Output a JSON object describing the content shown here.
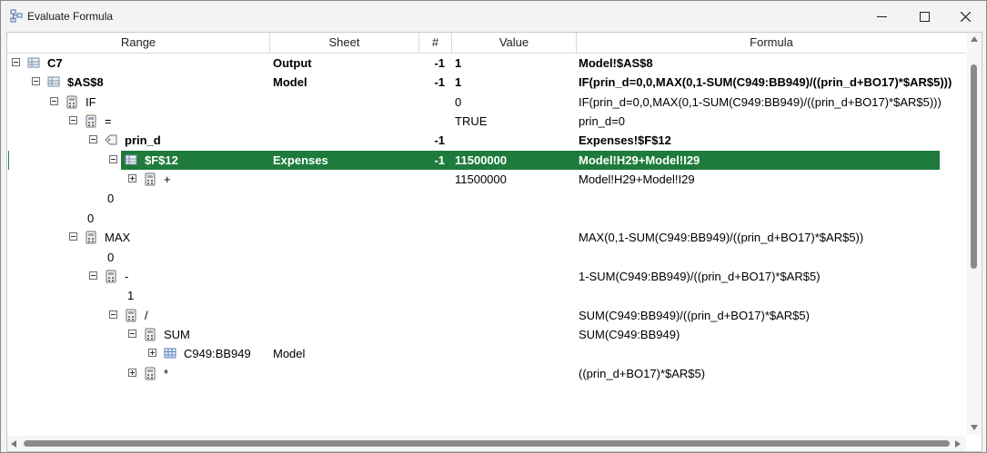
{
  "window": {
    "title": "Evaluate Formula"
  },
  "columns": {
    "range": "Range",
    "sheet": "Sheet",
    "num": "#",
    "value": "Value",
    "formula": "Formula"
  },
  "rows": [
    {
      "range": "C7",
      "sheet": "Output",
      "num": "-1",
      "value": "1",
      "formula": "Model!$AS$8",
      "bold": true,
      "icon": "range-icon"
    },
    {
      "range": "$AS$8",
      "sheet": "Model",
      "num": "-1",
      "value": "1",
      "formula": "IF(prin_d=0,0,MAX(0,1-SUM(C949:BB949)/((prin_d+BO17)*$AR$5)))",
      "bold": true,
      "icon": "range-icon"
    },
    {
      "range": "IF",
      "sheet": "",
      "num": "",
      "value": "0",
      "formula": "IF(prin_d=0,0,MAX(0,1-SUM(C949:BB949)/((prin_d+BO17)*$AR$5)))",
      "icon": "calculator-icon"
    },
    {
      "range": "=",
      "sheet": "",
      "num": "",
      "value": "TRUE",
      "formula": "prin_d=0",
      "icon": "calculator-icon"
    },
    {
      "range": "prin_d",
      "sheet": "",
      "num": "-1",
      "value": "",
      "formula": "Expenses!$F$12",
      "bold": true,
      "icon": "name-tag-icon"
    },
    {
      "range": "$F$12",
      "sheet": "Expenses",
      "num": "-1",
      "value": "11500000",
      "formula": "Model!H29+Model!I29",
      "bold": true,
      "selected": true,
      "icon": "range-icon"
    },
    {
      "range": "+",
      "sheet": "",
      "num": "",
      "value": "11500000",
      "formula": "Model!H29+Model!I29",
      "icon": "calculator-icon"
    },
    {
      "range": "0",
      "sheet": "",
      "num": "",
      "value": "",
      "formula": ""
    },
    {
      "range": "0",
      "sheet": "",
      "num": "",
      "value": "",
      "formula": ""
    },
    {
      "range": "MAX",
      "sheet": "",
      "num": "",
      "value": "",
      "formula": "MAX(0,1-SUM(C949:BB949)/((prin_d+BO17)*$AR$5))",
      "icon": "calculator-icon"
    },
    {
      "range": "0",
      "sheet": "",
      "num": "",
      "value": "",
      "formula": ""
    },
    {
      "range": "-",
      "sheet": "",
      "num": "",
      "value": "",
      "formula": "1-SUM(C949:BB949)/((prin_d+BO17)*$AR$5)",
      "icon": "calculator-icon"
    },
    {
      "range": "1",
      "sheet": "",
      "num": "",
      "value": "",
      "formula": ""
    },
    {
      "range": "/",
      "sheet": "",
      "num": "",
      "value": "",
      "formula": "SUM(C949:BB949)/((prin_d+BO17)*$AR$5)",
      "icon": "calculator-icon"
    },
    {
      "range": "SUM",
      "sheet": "",
      "num": "",
      "value": "",
      "formula": "SUM(C949:BB949)",
      "icon": "calculator-icon"
    },
    {
      "range": "C949:BB949",
      "sheet": "Model",
      "num": "",
      "value": "",
      "formula": "",
      "icon": "grid-range-icon"
    },
    {
      "range": "*",
      "sheet": "",
      "num": "",
      "value": "",
      "formula": "((prin_d+BO17)*$AR$5)",
      "icon": "calculator-icon"
    }
  ]
}
